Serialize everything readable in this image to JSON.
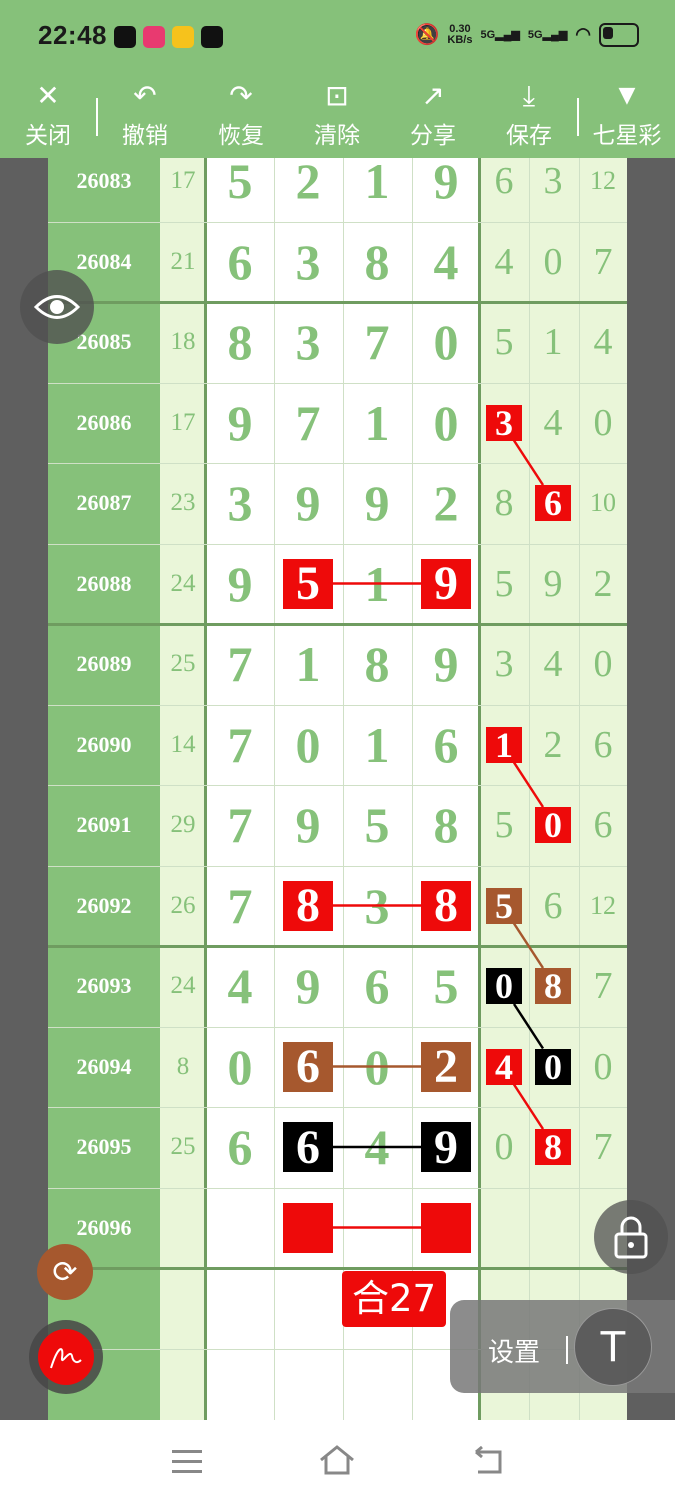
{
  "status_bar": {
    "time": "22:48",
    "speed_value": "0.30",
    "speed_unit": "KB/s",
    "sig1": "5G",
    "sig2": "5G"
  },
  "toolbar": {
    "close": "关闭",
    "undo": "撤销",
    "redo": "恢复",
    "clear": "清除",
    "share": "分享",
    "save": "保存",
    "lottery": "七星彩"
  },
  "rows": [
    {
      "period": "26083",
      "sum": "17",
      "d": [
        "5",
        "2",
        "1",
        "9"
      ],
      "r": [
        "6",
        "3",
        "12"
      ]
    },
    {
      "period": "26084",
      "sum": "21",
      "d": [
        "6",
        "3",
        "8",
        "4"
      ],
      "r": [
        "4",
        "0",
        "7"
      ]
    },
    {
      "period": "26085",
      "sum": "18",
      "d": [
        "8",
        "3",
        "7",
        "0"
      ],
      "r": [
        "5",
        "1",
        "4"
      ]
    },
    {
      "period": "26086",
      "sum": "17",
      "d": [
        "9",
        "7",
        "1",
        "0"
      ],
      "r": [
        "3",
        "4",
        "0"
      ]
    },
    {
      "period": "26087",
      "sum": "23",
      "d": [
        "3",
        "9",
        "9",
        "2"
      ],
      "r": [
        "8",
        "6",
        "10"
      ]
    },
    {
      "period": "26088",
      "sum": "24",
      "d": [
        "9",
        "5",
        "1",
        "9"
      ],
      "r": [
        "5",
        "9",
        "2"
      ]
    },
    {
      "period": "26089",
      "sum": "25",
      "d": [
        "7",
        "1",
        "8",
        "9"
      ],
      "r": [
        "3",
        "4",
        "0"
      ]
    },
    {
      "period": "26090",
      "sum": "14",
      "d": [
        "7",
        "0",
        "1",
        "6"
      ],
      "r": [
        "1",
        "2",
        "6"
      ]
    },
    {
      "period": "26091",
      "sum": "29",
      "d": [
        "7",
        "9",
        "5",
        "8"
      ],
      "r": [
        "5",
        "0",
        "6"
      ]
    },
    {
      "period": "26092",
      "sum": "26",
      "d": [
        "7",
        "8",
        "3",
        "8"
      ],
      "r": [
        "5",
        "6",
        "12"
      ]
    },
    {
      "period": "26093",
      "sum": "24",
      "d": [
        "4",
        "9",
        "6",
        "5"
      ],
      "r": [
        "0",
        "8",
        "7"
      ]
    },
    {
      "period": "26094",
      "sum": "8",
      "d": [
        "0",
        "6",
        "0",
        "2"
      ],
      "r": [
        "4",
        "0",
        "0"
      ]
    },
    {
      "period": "26095",
      "sum": "25",
      "d": [
        "6",
        "6",
        "4",
        "9"
      ],
      "r": [
        "0",
        "8",
        "7"
      ]
    },
    {
      "period": "26096",
      "sum": "",
      "d": [
        "",
        "",
        "",
        ""
      ],
      "r": [
        "",
        "",
        ""
      ]
    }
  ],
  "marks": [
    {
      "row": 5,
      "col": 1,
      "color": "red",
      "big": true
    },
    {
      "row": 5,
      "col": 3,
      "color": "red",
      "big": true
    },
    {
      "row": 9,
      "col": 1,
      "color": "red",
      "big": true
    },
    {
      "row": 9,
      "col": 3,
      "color": "red",
      "big": true
    },
    {
      "row": 11,
      "col": 1,
      "color": "brown",
      "big": true
    },
    {
      "row": 11,
      "col": 3,
      "color": "brown",
      "big": true
    },
    {
      "row": 12,
      "col": 1,
      "color": "black",
      "big": true
    },
    {
      "row": 12,
      "col": 3,
      "color": "black",
      "big": true
    },
    {
      "row": 13,
      "col": 1,
      "color": "red",
      "big": true,
      "empty": true
    },
    {
      "row": 13,
      "col": 3,
      "color": "red",
      "big": true,
      "empty": true
    },
    {
      "row": 3,
      "col": 4,
      "color": "red"
    },
    {
      "row": 4,
      "col": 5,
      "color": "red"
    },
    {
      "row": 7,
      "col": 4,
      "color": "red"
    },
    {
      "row": 8,
      "col": 5,
      "color": "red"
    },
    {
      "row": 9,
      "col": 4,
      "color": "brown"
    },
    {
      "row": 10,
      "col": 5,
      "color": "brown"
    },
    {
      "row": 10,
      "col": 4,
      "color": "black"
    },
    {
      "row": 11,
      "col": 5,
      "color": "black"
    },
    {
      "row": 11,
      "col": 4,
      "color": "red"
    },
    {
      "row": 12,
      "col": 5,
      "color": "red"
    }
  ],
  "connectors": [
    {
      "from": [
        5,
        1
      ],
      "to": [
        5,
        3
      ],
      "color": "#ee0a0a"
    },
    {
      "from": [
        9,
        1
      ],
      "to": [
        9,
        3
      ],
      "color": "#ee0a0a"
    },
    {
      "from": [
        11,
        1
      ],
      "to": [
        11,
        3
      ],
      "color": "#a6582e"
    },
    {
      "from": [
        12,
        1
      ],
      "to": [
        12,
        3
      ],
      "color": "#000000"
    },
    {
      "from": [
        13,
        1
      ],
      "to": [
        13,
        3
      ],
      "color": "#ee0a0a"
    },
    {
      "from": [
        3,
        4
      ],
      "to": [
        4,
        5
      ],
      "color": "#ee0a0a"
    },
    {
      "from": [
        7,
        4
      ],
      "to": [
        8,
        5
      ],
      "color": "#ee0a0a"
    },
    {
      "from": [
        9,
        4
      ],
      "to": [
        10,
        5
      ],
      "color": "#a6582e"
    },
    {
      "from": [
        10,
        4
      ],
      "to": [
        11,
        5
      ],
      "color": "#000000"
    },
    {
      "from": [
        11,
        4
      ],
      "to": [
        12,
        5
      ],
      "color": "#ee0a0a"
    }
  ],
  "sum_badge": "合27",
  "settings": {
    "label": "设置"
  },
  "colors": {
    "green": "#86c17a",
    "dark_green": "#6f9c60",
    "light_green": "#eaf6d9",
    "red": "#ee0a0a",
    "brown": "#a6582e"
  }
}
